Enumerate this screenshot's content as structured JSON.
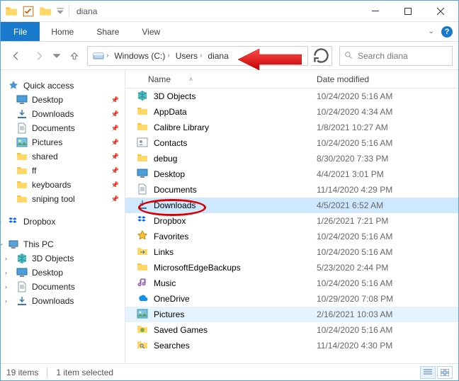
{
  "window": {
    "title": "diana"
  },
  "ribbon": {
    "file": "File",
    "tabs": [
      "Home",
      "Share",
      "View"
    ]
  },
  "breadcrumb": {
    "items": [
      "Windows (C:)",
      "Users",
      "diana"
    ]
  },
  "search": {
    "placeholder": "Search diana"
  },
  "columns": {
    "name": "Name",
    "date": "Date modified"
  },
  "sidebar": {
    "quick_access": "Quick access",
    "quick_items": [
      {
        "label": "Desktop"
      },
      {
        "label": "Downloads"
      },
      {
        "label": "Documents"
      },
      {
        "label": "Pictures"
      },
      {
        "label": "shared"
      },
      {
        "label": "ff"
      },
      {
        "label": "keyboards"
      },
      {
        "label": "sniping tool"
      }
    ],
    "dropbox": "Dropbox",
    "thispc": "This PC",
    "pc_items": [
      {
        "label": "3D Objects"
      },
      {
        "label": "Desktop"
      },
      {
        "label": "Documents"
      },
      {
        "label": "Downloads"
      }
    ]
  },
  "files": [
    {
      "name": "3D Objects",
      "date": "10/24/2020 5:16 AM",
      "icon": "3d"
    },
    {
      "name": "AppData",
      "date": "10/24/2020 4:34 AM",
      "icon": "folder"
    },
    {
      "name": "Calibre Library",
      "date": "1/8/2021 10:27 AM",
      "icon": "folder"
    },
    {
      "name": "Contacts",
      "date": "10/24/2020 5:16 AM",
      "icon": "contacts"
    },
    {
      "name": "debug",
      "date": "8/30/2020 7:33 PM",
      "icon": "folder"
    },
    {
      "name": "Desktop",
      "date": "4/4/2021 3:01 PM",
      "icon": "desktop"
    },
    {
      "name": "Documents",
      "date": "11/14/2020 4:29 PM",
      "icon": "documents"
    },
    {
      "name": "Downloads",
      "date": "4/5/2021 6:52 AM",
      "icon": "downloads"
    },
    {
      "name": "Dropbox",
      "date": "1/26/2021 7:21 PM",
      "icon": "dropbox"
    },
    {
      "name": "Favorites",
      "date": "10/24/2020 5:16 AM",
      "icon": "favorites"
    },
    {
      "name": "Links",
      "date": "10/24/2020 5:16 AM",
      "icon": "links"
    },
    {
      "name": "MicrosoftEdgeBackups",
      "date": "5/23/2020 2:44 PM",
      "icon": "folder"
    },
    {
      "name": "Music",
      "date": "10/24/2020 5:16 AM",
      "icon": "music"
    },
    {
      "name": "OneDrive",
      "date": "10/29/2020 7:08 PM",
      "icon": "onedrive"
    },
    {
      "name": "Pictures",
      "date": "2/16/2021 10:03 AM",
      "icon": "pictures"
    },
    {
      "name": "Saved Games",
      "date": "10/24/2020 5:16 AM",
      "icon": "games"
    },
    {
      "name": "Searches",
      "date": "11/14/2020 4:30 PM",
      "icon": "search"
    }
  ],
  "status": {
    "count": "19 items",
    "selected": "1 item selected"
  },
  "selection": {
    "selected_index": 7,
    "inactive_index": 14
  }
}
